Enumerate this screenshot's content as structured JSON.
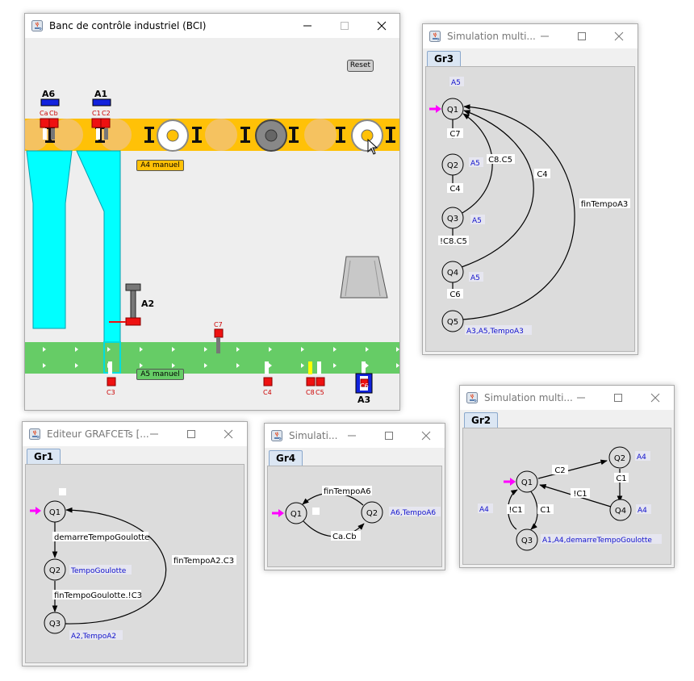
{
  "bci": {
    "title": "Banc de contrôle industriel (BCI)",
    "reset_label": "Reset",
    "a4_manual_label": "A4 manuel",
    "a5_manual_label": "A5 manuel",
    "labels": {
      "a6": "A6",
      "a1": "A1",
      "a2": "A2",
      "a3": "A3"
    },
    "sensors": {
      "ca": "Ca",
      "cb": "Cb",
      "c1": "C1",
      "c2": "C2",
      "c3": "C3",
      "c4": "C4",
      "c5": "C5",
      "c6": "C6",
      "c7": "C7",
      "c8": "C8"
    },
    "colors": {
      "conveyor_top": "#ffc107",
      "conveyor_bottom": "#66cc66",
      "chute": "#00ffff",
      "sensor": "#ee1111",
      "actuator": "#1122dd"
    }
  },
  "gr3": {
    "title": "Simulation multi...",
    "tab": "Gr3",
    "states": [
      "Q1",
      "Q2",
      "Q3",
      "Q4",
      "Q5"
    ],
    "actions": {
      "top": "A5",
      "q2": "A5",
      "q3": "A5",
      "q4": "A5",
      "q5": "A3,A5,TempoA3"
    },
    "transitions": {
      "q1_q2": "C7",
      "q2_q3": "C4",
      "q3_q4": "!C8.C5",
      "q4_q5": "C6",
      "q3_q1": "C8.C5",
      "q4_q1": "C4",
      "q5_q1": "finTempoA3"
    }
  },
  "gr1": {
    "title": "Editeur GRAFCETs [...",
    "tab": "Gr1",
    "states": [
      "Q1",
      "Q2",
      "Q3"
    ],
    "actions": {
      "q2": "TempoGoulotte",
      "q3": "A2,TempoA2"
    },
    "transitions": {
      "q1_q2": "demarreTempoGoulotte",
      "q2_q3": "finTempoGoulotte.!C3",
      "q3_q1": "finTempoA2.C3"
    }
  },
  "gr4": {
    "title": "Simulati...",
    "tab": "Gr4",
    "states": [
      "Q1",
      "Q2"
    ],
    "actions": {
      "q2": "A6,TempoA6"
    },
    "transitions": {
      "q2_q1": "finTempoA6",
      "q1_q2": "Ca.Cb"
    }
  },
  "gr2": {
    "title": "Simulation multi...",
    "tab": "Gr2",
    "states": [
      "Q1",
      "Q2",
      "Q3",
      "Q4"
    ],
    "actions": {
      "q2": "A4",
      "q4": "A4",
      "left": "A4",
      "q3": "A1,A4,demarreTempoGoulotte"
    },
    "transitions": {
      "q1_q2": "C2",
      "q2_q4": "C1",
      "q4_q1": "!C1",
      "q3_q1": "!C1",
      "q1_q3": "C1"
    }
  }
}
